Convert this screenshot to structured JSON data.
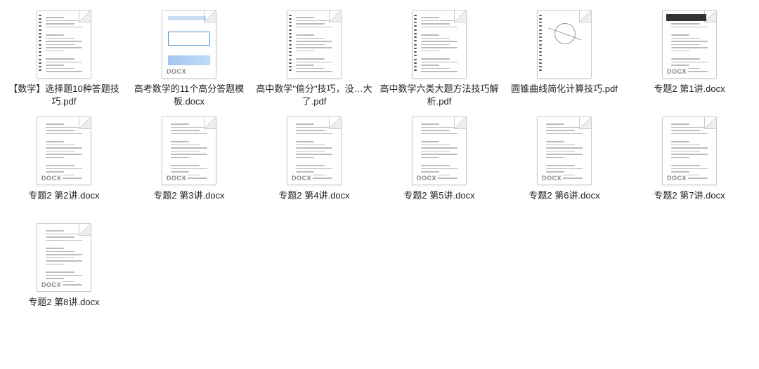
{
  "files": [
    {
      "name": "【数学】选择题10种答题技巧.pdf",
      "badge": "",
      "type": "pdf",
      "variant": "spiral"
    },
    {
      "name": "高考数学的11个高分答题模板.docx",
      "badge": "DOCX",
      "type": "docx",
      "variant": "colorful"
    },
    {
      "name": "高中数学\"偷分\"技巧，没…大了.pdf",
      "badge": "",
      "type": "pdf",
      "variant": "spiral"
    },
    {
      "name": "高中数学六类大题方法技巧解析.pdf",
      "badge": "",
      "type": "pdf",
      "variant": "spiral"
    },
    {
      "name": "圆锥曲线简化计算技巧.pdf",
      "badge": "",
      "type": "pdf",
      "variant": "geom"
    },
    {
      "name": "专题2 第1讲.docx",
      "badge": "DOCX",
      "type": "docx",
      "variant": "header"
    },
    {
      "name": "专题2 第2讲.docx",
      "badge": "DOCX",
      "type": "docx",
      "variant": "plain"
    },
    {
      "name": "专题2 第3讲.docx",
      "badge": "DOCX",
      "type": "docx",
      "variant": "plain"
    },
    {
      "name": "专题2 第4讲.docx",
      "badge": "DOCX",
      "type": "docx",
      "variant": "plain"
    },
    {
      "name": "专题2 第5讲.docx",
      "badge": "DOCX",
      "type": "docx",
      "variant": "plain"
    },
    {
      "name": "专题2 第6讲.docx",
      "badge": "DOCX",
      "type": "docx",
      "variant": "plain"
    },
    {
      "name": "专题2 第7讲.docx",
      "badge": "DOCX",
      "type": "docx",
      "variant": "plain"
    },
    {
      "name": "专题2 第8讲.docx",
      "badge": "DOCX",
      "type": "docx",
      "variant": "plain"
    }
  ]
}
